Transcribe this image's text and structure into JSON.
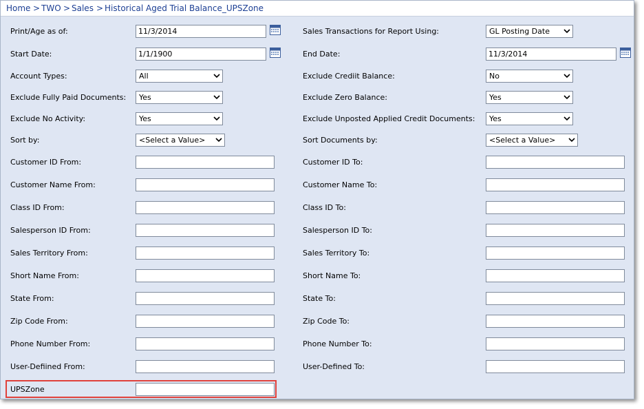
{
  "breadcrumb": {
    "home": "Home",
    "company": "TWO",
    "module": "Sales",
    "report": "Historical Aged Trial Balance_UPSZone",
    "separator": ">"
  },
  "left": {
    "print_age_as_of": {
      "label": "Print/Age as of:",
      "value": "11/3/2014"
    },
    "start_date": {
      "label": "Start Date:",
      "value": "1/1/1900"
    },
    "account_types": {
      "label": "Account Types:",
      "value": "All"
    },
    "exclude_fully_paid": {
      "label": "Exclude Fully Paid Documents:",
      "value": "Yes"
    },
    "exclude_no_activity": {
      "label": "Exclude No Activity:",
      "value": "Yes"
    },
    "sort_by": {
      "label": "Sort by:",
      "value": "<Select a Value>"
    },
    "customer_id_from": {
      "label": "Customer ID From:",
      "value": ""
    },
    "customer_name_from": {
      "label": "Customer Name From:",
      "value": ""
    },
    "class_id_from": {
      "label": "Class ID From:",
      "value": ""
    },
    "salesperson_id_from": {
      "label": "Salesperson ID From:",
      "value": ""
    },
    "sales_territory_from": {
      "label": "Sales Territory From:",
      "value": ""
    },
    "short_name_from": {
      "label": "Short Name From:",
      "value": ""
    },
    "state_from": {
      "label": "State From:",
      "value": ""
    },
    "zip_code_from": {
      "label": "Zip Code From:",
      "value": ""
    },
    "phone_number_from": {
      "label": "Phone Number From:",
      "value": ""
    },
    "user_defined_from": {
      "label": "User-Defiined From:",
      "value": ""
    },
    "upszone": {
      "label": "UPSZone",
      "value": ""
    }
  },
  "right": {
    "sales_transactions_using": {
      "label": "Sales Transactions for Report Using:",
      "value": "GL Posting Date"
    },
    "end_date": {
      "label": "End Date:",
      "value": "11/3/2014"
    },
    "exclude_credit_balance": {
      "label": "Exclude Crediit Balance:",
      "value": "No"
    },
    "exclude_zero_balance": {
      "label": "Exclude Zero Balance:",
      "value": "Yes"
    },
    "exclude_unposted_applied": {
      "label": "Exclude Unposted Applied Credit Documents:",
      "value": "Yes"
    },
    "sort_documents_by": {
      "label": "Sort Documents by:",
      "value": "<Select a Value>"
    },
    "customer_id_to": {
      "label": "Customer ID To:",
      "value": ""
    },
    "customer_name_to": {
      "label": "Customer Name To:",
      "value": ""
    },
    "class_id_to": {
      "label": "Class ID To:",
      "value": ""
    },
    "salesperson_id_to": {
      "label": "Salesperson ID To:",
      "value": ""
    },
    "sales_territory_to": {
      "label": "Sales Territory To:",
      "value": ""
    },
    "short_name_to": {
      "label": "Short Name To:",
      "value": ""
    },
    "state_to": {
      "label": "State To:",
      "value": ""
    },
    "zip_code_to": {
      "label": "Zip Code To:",
      "value": ""
    },
    "phone_number_to": {
      "label": "Phone Number To:",
      "value": ""
    },
    "user_defined_to": {
      "label": "User-Defined To:",
      "value": ""
    }
  },
  "colors": {
    "highlight": "#e0403a",
    "panel": "#dfe6f3",
    "link": "#1c3f94"
  },
  "icons": {
    "calendar": "calendar-icon",
    "dropdown": "chevron-down-icon"
  }
}
